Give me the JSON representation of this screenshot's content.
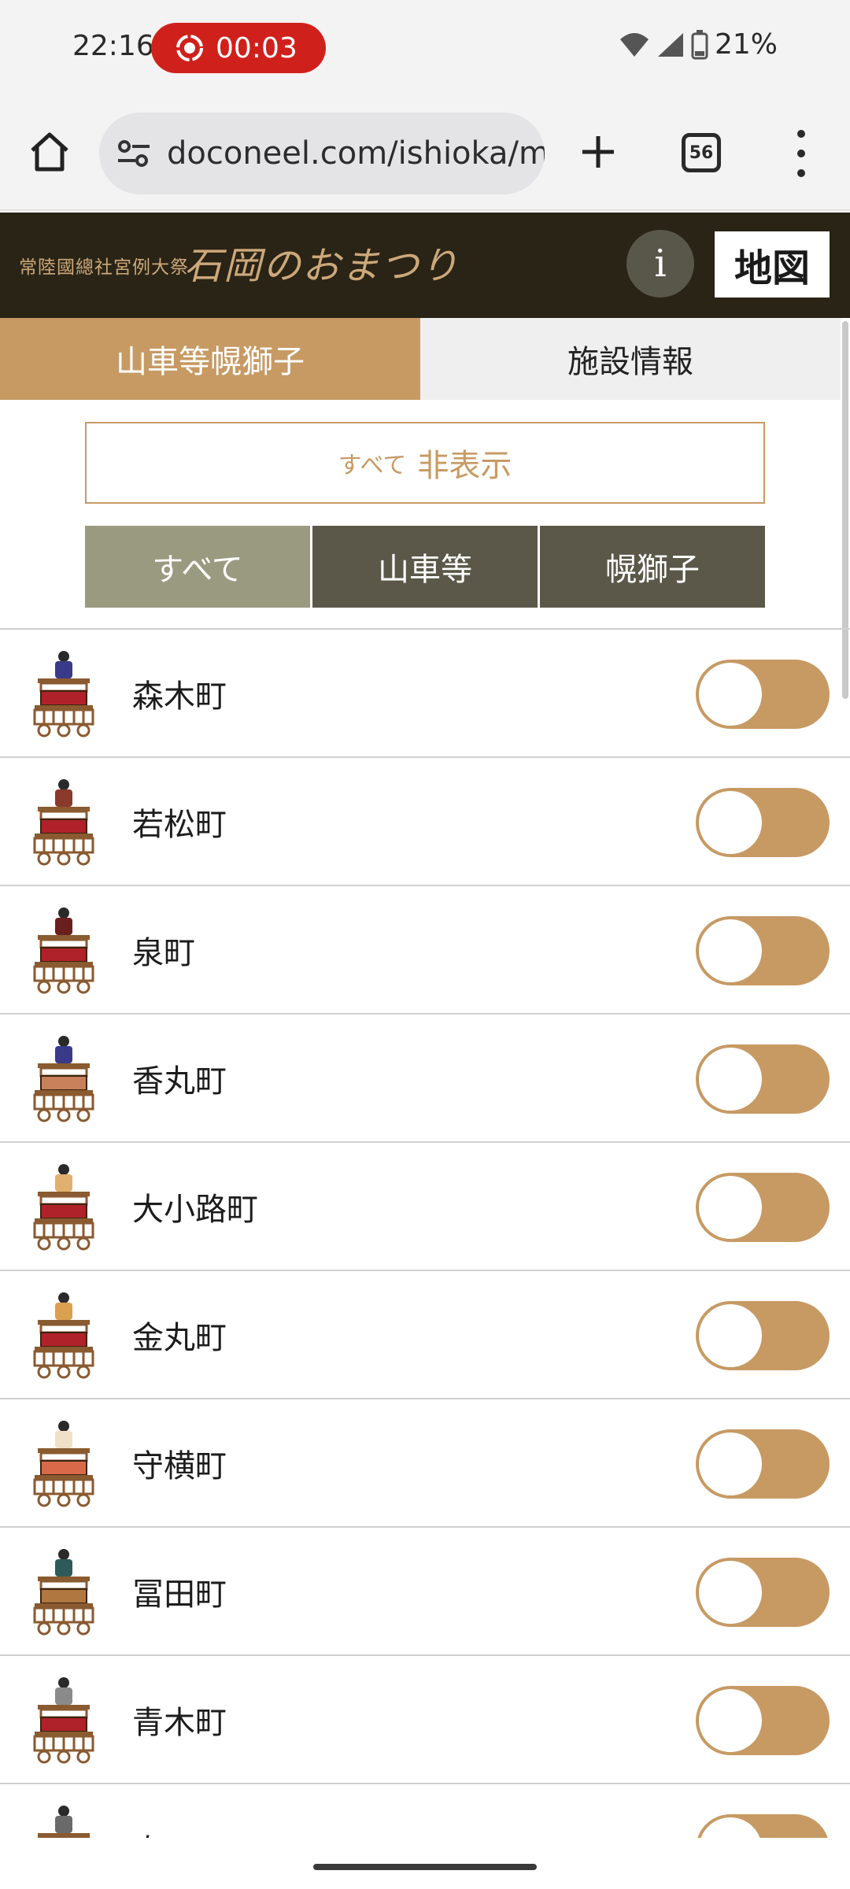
{
  "status_bar": {
    "time": "22:16",
    "recording_timer": "00:03",
    "battery": "21%"
  },
  "browser": {
    "url": "doconeel.com/ishioka/m",
    "tab_count": "56"
  },
  "site": {
    "subtitle": "常陸國總社宮例大祭",
    "title": "石岡のおまつり",
    "info_label": "i",
    "map_label": "地図"
  },
  "category_tabs": [
    {
      "label": "山車等幌獅子",
      "active": true
    },
    {
      "label": "施設情報",
      "active": false
    }
  ],
  "hide_all": {
    "prefix": "すべて",
    "label": "非表示"
  },
  "filters": [
    {
      "label": "すべて",
      "active": true
    },
    {
      "label": "山車等",
      "active": false
    },
    {
      "label": "幌獅子",
      "active": false
    }
  ],
  "towns": [
    {
      "name": "森木町",
      "figure": "#3a3a8a",
      "base": "#b0222a"
    },
    {
      "name": "若松町",
      "figure": "#8a3a2a",
      "base": "#b0222a"
    },
    {
      "name": "泉町",
      "figure": "#6a1f1f",
      "base": "#b0222a"
    },
    {
      "name": "香丸町",
      "figure": "#3a3a8a",
      "base": "#c8815a"
    },
    {
      "name": "大小路町",
      "figure": "#e0b070",
      "base": "#b0222a"
    },
    {
      "name": "金丸町",
      "figure": "#d9a050",
      "base": "#b0222a"
    },
    {
      "name": "守横町",
      "figure": "#f0e0c8",
      "base": "#d86a4a"
    },
    {
      "name": "冨田町",
      "figure": "#2e5a5a",
      "base": "#b07840"
    },
    {
      "name": "青木町",
      "figure": "#8a8a8a",
      "base": "#b0222a"
    },
    {
      "name": "泰町",
      "figure": "#6a6a6a",
      "base": "#b0222a"
    }
  ],
  "colors": {
    "accent": "#c79a64",
    "header_bg": "#2a2416",
    "filter_active": "#9a9a80",
    "filter_inactive": "#5b5849",
    "record_red": "#d0201b"
  }
}
